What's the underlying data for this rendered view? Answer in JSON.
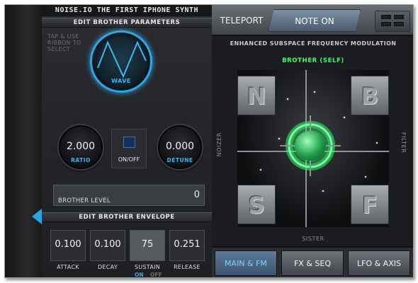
{
  "app": {
    "title": "NOISE.IO THE FIRST IPHONE SYNTH"
  },
  "left_panel": {
    "header": "EDIT BROTHER PARAMETERS",
    "hint": "TAP & USE RIBBON TO SELECT",
    "wave": {
      "label": "WAVE",
      "shape": "triangle"
    },
    "ratio": {
      "value": "2.000",
      "label": "RATIO"
    },
    "onoff": {
      "label": "ON/OFF"
    },
    "detune": {
      "value": "0.000",
      "label": "DETUNE"
    },
    "brother_level": {
      "label": "BROTHER LEVEL",
      "value": "0"
    },
    "envelope_header": "EDIT BROTHER ENVELOPE",
    "envelope": [
      {
        "label": "ATTACK",
        "value": "0.100"
      },
      {
        "label": "DECAY",
        "value": "0.100"
      },
      {
        "label": "SUSTAIN",
        "value": "75"
      },
      {
        "label": "RELEASE",
        "value": "0.251"
      }
    ],
    "sustain_on": "ON",
    "sustain_off": "OFF"
  },
  "right_panel": {
    "teleport_label": "TELEPORT",
    "note_on_label": "NOTE ON",
    "subtitle": "ENHANCED SUBSPACE FREQUENCY MODULATION",
    "brother_self": "BROTHER (SELF)",
    "corners": {
      "top_left": "N",
      "top_right": "B",
      "bottom_left": "S",
      "bottom_right": "F"
    },
    "axis_labels": {
      "left": "NOIZER",
      "right": "FILTER",
      "bottom": "SISTER"
    },
    "tabs": [
      {
        "label": "MAIN & FM",
        "active": true
      },
      {
        "label": "FX & SEQ",
        "active": false
      },
      {
        "label": "LFO & AXIS",
        "active": false
      }
    ]
  },
  "colors": {
    "accent_blue": "#2ea8e4",
    "accent_green": "#2eff6a"
  }
}
